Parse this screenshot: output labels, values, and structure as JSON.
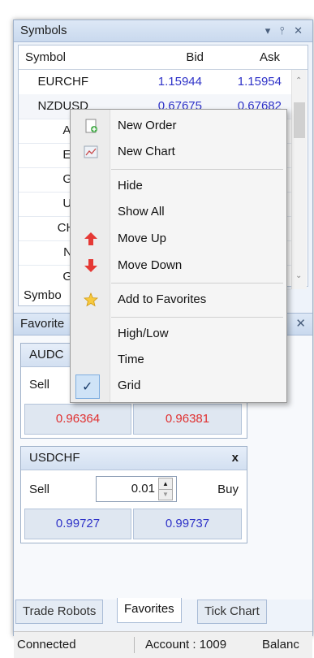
{
  "symbols_panel": {
    "title": "Symbols",
    "title_icons": "▾ ⫯ ✕",
    "columns": {
      "symbol": "Symbol",
      "bid": "Bid",
      "ask": "Ask"
    },
    "rows": [
      {
        "symbol": "EURCHF",
        "bid": "1.15944",
        "ask": "1.15954"
      },
      {
        "symbol": "NZDUSD",
        "bid": "0.67675",
        "ask": "0.67682"
      },
      {
        "symbol": "AUD",
        "bid": "",
        "ask": ""
      },
      {
        "symbol": "EUR",
        "bid": "",
        "ask": ""
      },
      {
        "symbol": "GBP",
        "bid": "",
        "ask": ""
      },
      {
        "symbol": "USD",
        "bid": "",
        "ask": ""
      },
      {
        "symbol": "CHFJ",
        "bid": "",
        "ask": ""
      },
      {
        "symbol": "NZD",
        "bid": "",
        "ask": ""
      },
      {
        "symbol": "GBP",
        "bid": "",
        "ask": ""
      }
    ],
    "bottom_tab": "Symbo"
  },
  "context_menu": {
    "items": [
      {
        "label": "New Order",
        "icon": "new-order-icon"
      },
      {
        "label": "New Chart",
        "icon": "new-chart-icon"
      },
      {
        "label": "Hide",
        "icon": ""
      },
      {
        "label": "Show All",
        "icon": ""
      },
      {
        "label": "Move Up",
        "icon": "arrow-up-icon"
      },
      {
        "label": "Move Down",
        "icon": "arrow-down-icon"
      },
      {
        "label": "Add to Favorites",
        "icon": "star-icon"
      },
      {
        "label": "High/Low",
        "icon": ""
      },
      {
        "label": "Time",
        "icon": ""
      },
      {
        "label": "Grid",
        "icon": "check-icon",
        "checked": true
      }
    ]
  },
  "favorites_panel": {
    "title": "Favorite",
    "close": "✕",
    "tile1": {
      "symbol": "AUDC",
      "sell_label": "Sell",
      "sell_price": "0.96364",
      "buy_price": "0.96381",
      "price_color": "#e03030"
    },
    "tile2": {
      "symbol": "USDCHF",
      "close": "x",
      "sell_label": "Sell",
      "buy_label": "Buy",
      "volume": "0.01",
      "sell_price": "0.99727",
      "buy_price": "0.99737",
      "price_color": "#2f33c8"
    }
  },
  "tabs": [
    "Trade Robots",
    "Favorites",
    "Tick Chart"
  ],
  "status_bar": {
    "connection": "Connected",
    "account": "Account : 1009",
    "balance": "Balanc"
  }
}
